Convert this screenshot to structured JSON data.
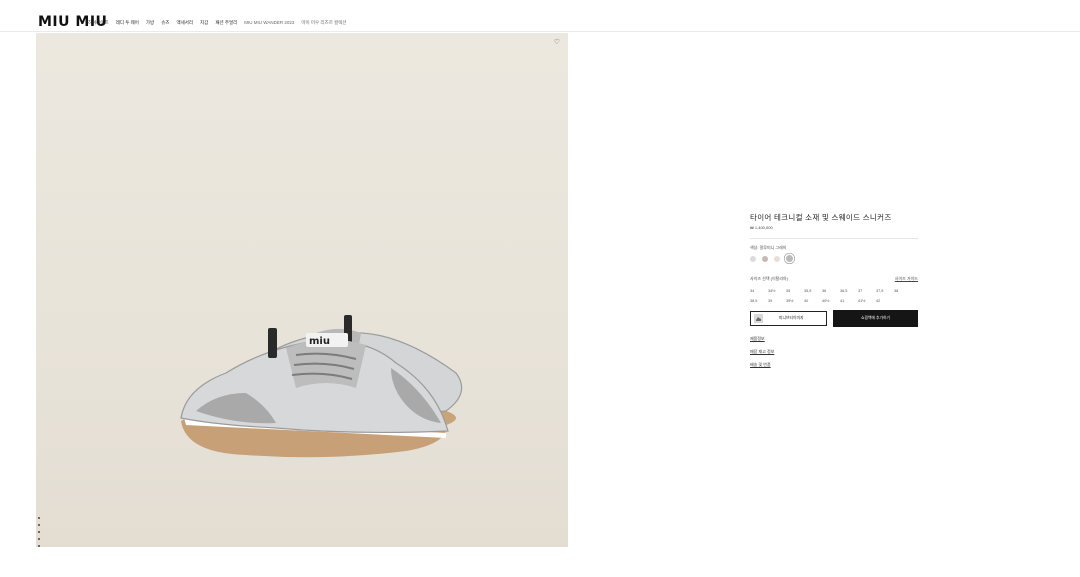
{
  "brand": {
    "logo": "MIU MIU"
  },
  "nav": {
    "items": [
      "하이라이트",
      "레디 투 웨어",
      "가방",
      "슈즈",
      "액세서리",
      "지갑",
      "패션 주얼리"
    ],
    "muted_items": [
      "MIU MIU WANDER 2023",
      "마이 미우 리즈르 컬렉션"
    ]
  },
  "gallery": {
    "wishlist_icon": "heart-icon",
    "dot_count": 5
  },
  "product": {
    "title": "타이어 테크니컬 소재 및 스웨이드 스니커즈",
    "price": "₩ 1,400,000",
    "color_label": "색상: 알루미니 그레이",
    "swatches": [
      "#dcdcdc",
      "#c8b8b4",
      "#e6dfd3",
      "#b9b9b9"
    ],
    "selected_swatch": 3,
    "size_label": "사이즈 선택 (이탈리아)",
    "size_guide": "사이즈 가이드",
    "sizes": [
      "34",
      "34½",
      "35",
      "35,5",
      "36",
      "36,5",
      "37",
      "37,5",
      "38",
      "38,5",
      "39",
      "39½",
      "40",
      "40½",
      "41",
      "41½",
      "42"
    ],
    "outline_button": "미니브티이미지",
    "dark_button": "쇼핑백에 추가하기",
    "links": [
      "제품정보",
      "매장 재고 정보",
      "배송 및 반품"
    ]
  }
}
